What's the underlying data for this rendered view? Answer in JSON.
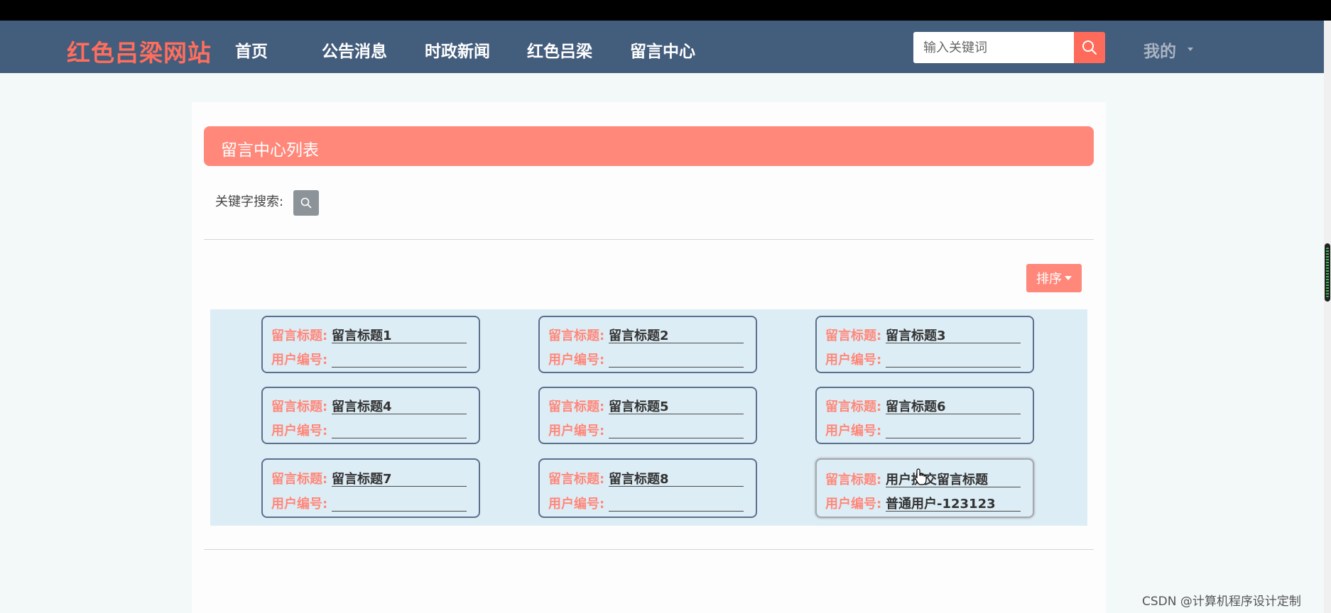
{
  "nav": {
    "logo": "红色吕梁网站",
    "items": [
      {
        "label": "首页"
      },
      {
        "label": "公告消息"
      },
      {
        "label": "时政新闻"
      },
      {
        "label": "红色吕梁"
      },
      {
        "label": "留言中心"
      }
    ],
    "search_placeholder": "输入关键词",
    "my_label": "我的"
  },
  "list": {
    "title": "留言中心列表",
    "keyword_label": "关键字搜索:",
    "sort_label": "排序",
    "field_title_label": "留言标题:",
    "field_user_label": "用户编号:",
    "cards": [
      {
        "title": "留言标题1",
        "user": ""
      },
      {
        "title": "留言标题2",
        "user": ""
      },
      {
        "title": "留言标题3",
        "user": ""
      },
      {
        "title": "留言标题4",
        "user": ""
      },
      {
        "title": "留言标题5",
        "user": ""
      },
      {
        "title": "留言标题6",
        "user": ""
      },
      {
        "title": "留言标题7",
        "user": ""
      },
      {
        "title": "留言标题8",
        "user": ""
      },
      {
        "title": "用户提交留言标题",
        "user": "普通用户-123123"
      }
    ]
  },
  "watermark": "CSDN @计算机程序设计定制",
  "colors": {
    "nav_bg": "#435d7d",
    "accent": "#ff887b",
    "logo": "#ff6e5c",
    "grid_bg": "#ddedf5",
    "card_border": "#5b6f8e"
  },
  "icons": {
    "search": "search-icon",
    "caret": "caret-down-icon",
    "cursor": "hand-pointer-icon"
  }
}
